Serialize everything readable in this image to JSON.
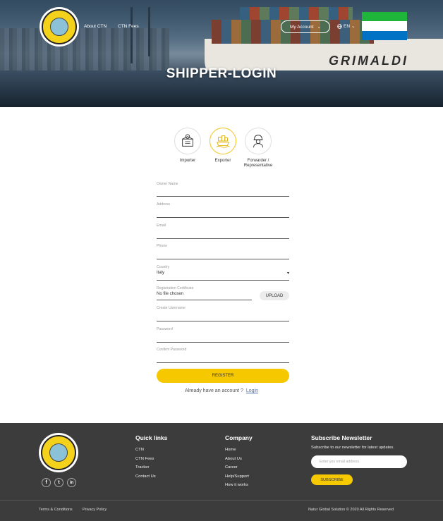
{
  "header": {
    "nav_links": [
      "About CTN",
      "CTN Fees"
    ],
    "account_label": "My Account",
    "language": "EN",
    "page_title": "SHIPPER-LOGIN",
    "ship_name": "GRIMALDI"
  },
  "flag_colors": [
    "#1eb53a",
    "#ffffff",
    "#0072c6"
  ],
  "roles": [
    {
      "label": "Importer",
      "icon": "importer-icon",
      "active": false
    },
    {
      "label": "Exporter",
      "icon": "exporter-icon",
      "active": true
    },
    {
      "label": "Forwarder / Representative",
      "icon": "forwarder-icon",
      "active": false
    }
  ],
  "form": {
    "owner_name_label": "Owner Name",
    "address_label": "Address",
    "email_label": "Email",
    "phone_label": "Phone",
    "country_label": "Country",
    "country_value": "Italy",
    "reg_cert_label": "Registration Certificate",
    "reg_cert_value": "No file chosen",
    "upload_label": "UPLOAD",
    "username_label": "Create Username",
    "password_label": "Password",
    "confirm_password_label": "Confirm Password",
    "register_label": "REGISTER",
    "already_text": "Already have an account ?",
    "login_link": "Login"
  },
  "footer": {
    "quick_links_title": "Quick links",
    "quick_links": [
      "CTN",
      "CTN Fees",
      "Tracker",
      "Contact Us"
    ],
    "company_title": "Company",
    "company_links": [
      "Home",
      "About Us",
      "Career",
      "Help/Support",
      "How it works"
    ],
    "newsletter_title": "Subscribe Newsletter",
    "newsletter_sub": "Subscribe to our newsletter for latest updates.",
    "email_placeholder": "Enter you email address.",
    "subscribe_label": "SUBSCRIBE",
    "terms": "Terms & Conditions",
    "privacy": "Privacy Policy",
    "copyright": "Natur Global Solution © 2020 All Rights Reserved",
    "social": [
      "f",
      "t",
      "in"
    ]
  },
  "accent_color": "#f5c800"
}
